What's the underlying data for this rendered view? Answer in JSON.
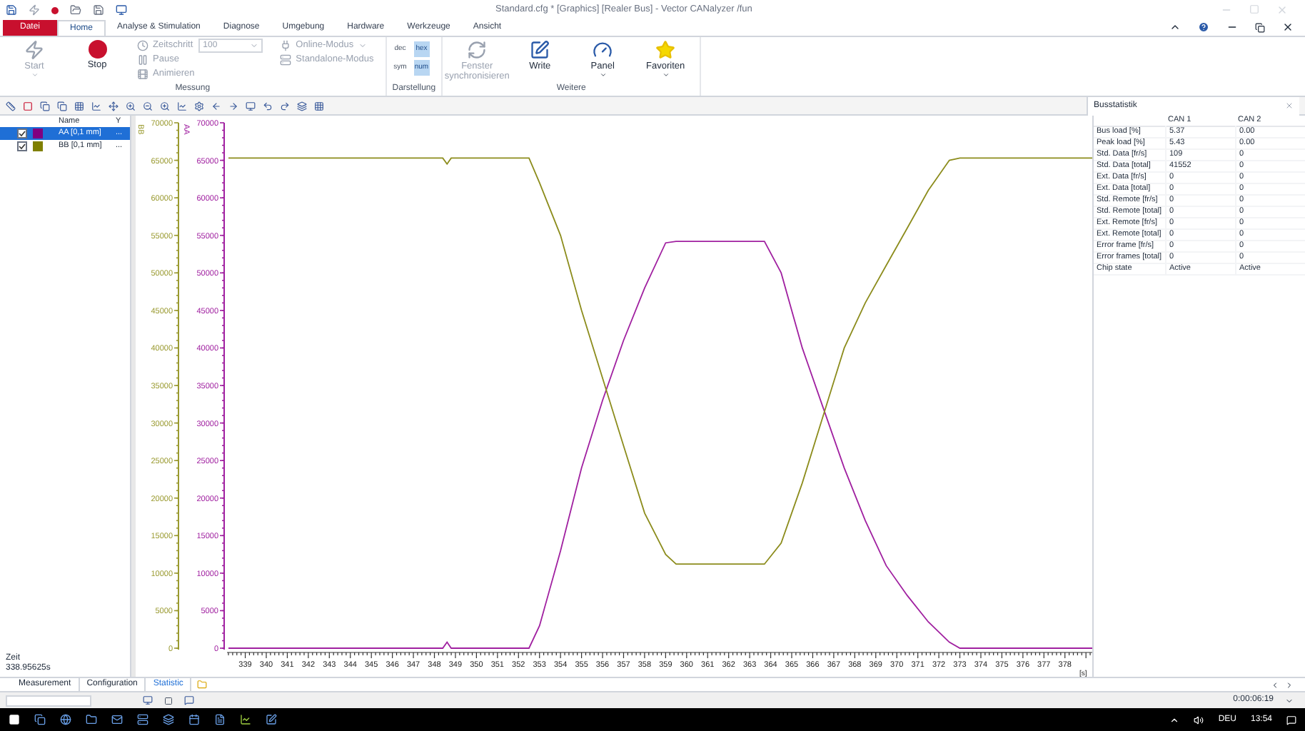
{
  "window": {
    "title": "Standard.cfg * [Graphics] [Realer Bus] - Vector CANalyzer /fun"
  },
  "ribbon_tabs": [
    {
      "label": "Datei",
      "kind": "file",
      "selected": false
    },
    {
      "label": "Home",
      "kind": "tab",
      "selected": true
    },
    {
      "label": "Analyse & Stimulation",
      "kind": "tab",
      "selected": false
    },
    {
      "label": "Diagnose",
      "kind": "tab",
      "selected": false
    },
    {
      "label": "Umgebung",
      "kind": "tab",
      "selected": false
    },
    {
      "label": "Hardware",
      "kind": "tab",
      "selected": false
    },
    {
      "label": "Werkzeuge",
      "kind": "tab",
      "selected": false
    },
    {
      "label": "Ansicht",
      "kind": "tab",
      "selected": false
    }
  ],
  "ribbon_groups": [
    {
      "label": "Messung",
      "columns": [
        [
          {
            "kind": "big",
            "label": "Start",
            "caret": true,
            "disabled": true
          }
        ],
        [
          {
            "kind": "big",
            "label": "Stop",
            "caret": false,
            "disabled": false
          }
        ],
        [
          {
            "kind": "small",
            "label": "Zeitschritt",
            "value": "100",
            "disabled": true
          },
          {
            "kind": "small",
            "label": "Pause",
            "disabled": true
          },
          {
            "kind": "small",
            "label": "Animieren",
            "disabled": true
          }
        ],
        [
          {
            "kind": "small",
            "label": "Online-Modus",
            "caret": true,
            "disabled": true
          },
          {
            "kind": "small",
            "label": "Standalone-Modus",
            "disabled": true
          }
        ]
      ]
    },
    {
      "label": "Darstellung",
      "columns": [
        [
          {
            "kind": "toggle",
            "label": "dec",
            "selected": false
          },
          {
            "kind": "toggle",
            "label": "sym",
            "selected": false
          }
        ],
        [
          {
            "kind": "toggle",
            "label": "hex",
            "selected": true
          },
          {
            "kind": "toggle",
            "label": "num",
            "selected": true
          }
        ]
      ]
    },
    {
      "label": "Weitere",
      "columns": [
        [
          {
            "kind": "big",
            "label": "Fenster synchronisieren",
            "caret": false,
            "disabled": true
          }
        ],
        [
          {
            "kind": "big",
            "label": "Write",
            "caret": false,
            "disabled": false
          }
        ],
        [
          {
            "kind": "big",
            "label": "Panel",
            "caret": true,
            "disabled": false
          }
        ],
        [
          {
            "kind": "big",
            "label": "Favoriten",
            "caret": true,
            "disabled": false
          }
        ]
      ]
    }
  ],
  "signals": {
    "columns": [
      "Name",
      "Y"
    ],
    "rows": [
      {
        "name": "AA [0,1 mm]",
        "y": "...",
        "checked": true,
        "selected": true,
        "color": "#800080"
      },
      {
        "name": "BB [0,1 mm]",
        "y": "...",
        "checked": true,
        "selected": false,
        "color": "#808000"
      }
    ]
  },
  "time": {
    "label": "Zeit",
    "value": "338.95625s"
  },
  "graph": {
    "y_axes": [
      {
        "color": "#9a9a30",
        "ticks": [
          "70000",
          "65000",
          "60000",
          "55000",
          "50000",
          "45000",
          "40000",
          "35000",
          "30000",
          "25000",
          "20000",
          "15000",
          "10000",
          "5000",
          "0"
        ]
      },
      {
        "color": "#a020a0"
      }
    ],
    "chart_data": {
      "type": "line",
      "xlabel": "[s]",
      "xlim": [
        338.2,
        379.3
      ],
      "ylim": [
        0,
        70000
      ],
      "x": [
        338.2,
        348.4,
        348.6,
        348.8,
        352.5,
        353,
        354,
        355,
        356,
        357,
        358,
        359,
        359.5,
        363.7,
        364.5,
        365.5,
        366.5,
        367.5,
        368.5,
        369.5,
        370.5,
        371.5,
        372.5,
        373,
        379.3
      ],
      "series": [
        {
          "name": "AA",
          "color": "#a020a0",
          "values": [
            0,
            0,
            800,
            0,
            0,
            3000,
            13000,
            24000,
            33000,
            41000,
            48000,
            54000,
            54200,
            54200,
            50000,
            40000,
            32000,
            24000,
            17000,
            11000,
            7000,
            3500,
            800,
            0,
            0
          ]
        },
        {
          "name": "BB",
          "color": "#8c8c1c",
          "values": [
            65300,
            65300,
            64500,
            65300,
            65300,
            62000,
            55000,
            45000,
            36000,
            27000,
            18000,
            12500,
            11200,
            11200,
            14000,
            22000,
            31000,
            40000,
            46000,
            51000,
            56000,
            61000,
            65000,
            65300,
            65300
          ]
        }
      ],
      "xticks": [
        339,
        340,
        341,
        342,
        343,
        344,
        345,
        346,
        347,
        348,
        349,
        350,
        351,
        352,
        353,
        354,
        355,
        356,
        357,
        358,
        359,
        360,
        361,
        362,
        363,
        364,
        365,
        366,
        367,
        368,
        369,
        370,
        371,
        372,
        373,
        374,
        375,
        376,
        377,
        378
      ],
      "yticks": [
        70000,
        65000,
        60000,
        55000,
        50000,
        45000,
        40000,
        35000,
        30000,
        25000,
        20000,
        15000,
        10000,
        5000,
        0
      ]
    }
  },
  "statistics": {
    "title": "Busstatistik",
    "columns": [
      "CAN 1",
      "CAN 2"
    ],
    "rows": [
      {
        "label": "Bus load [%]",
        "values": [
          "5.37",
          "0.00"
        ]
      },
      {
        "label": "Peak load [%]",
        "values": [
          "5.43",
          "0.00"
        ]
      },
      {
        "label": "Std. Data [fr/s]",
        "values": [
          "109",
          "0"
        ]
      },
      {
        "label": "Std. Data [total]",
        "values": [
          "41552",
          "0"
        ]
      },
      {
        "label": "Ext. Data [fr/s]",
        "values": [
          "0",
          "0"
        ]
      },
      {
        "label": "Ext. Data [total]",
        "values": [
          "0",
          "0"
        ]
      },
      {
        "label": "Std. Remote [fr/s]",
        "values": [
          "0",
          "0"
        ]
      },
      {
        "label": "Std. Remote [total]",
        "values": [
          "0",
          "0"
        ]
      },
      {
        "label": "Ext. Remote [fr/s]",
        "values": [
          "0",
          "0"
        ]
      },
      {
        "label": "Ext. Remote [total]",
        "values": [
          "0",
          "0"
        ]
      },
      {
        "label": "Error frame [fr/s]",
        "values": [
          "0",
          "0"
        ]
      },
      {
        "label": "Error frames [total]",
        "values": [
          "0",
          "0"
        ]
      },
      {
        "label": "Chip state",
        "values": [
          "Active",
          "Active"
        ]
      }
    ]
  },
  "bottom_tabs": [
    {
      "label": "Measurement",
      "selected": false
    },
    {
      "label": "Configuration",
      "selected": false
    },
    {
      "label": "Statistic",
      "selected": true
    }
  ],
  "status_bar": {
    "time": "0:00:06:19"
  },
  "taskbar": {
    "language": "DEU",
    "clock": "13:54"
  }
}
